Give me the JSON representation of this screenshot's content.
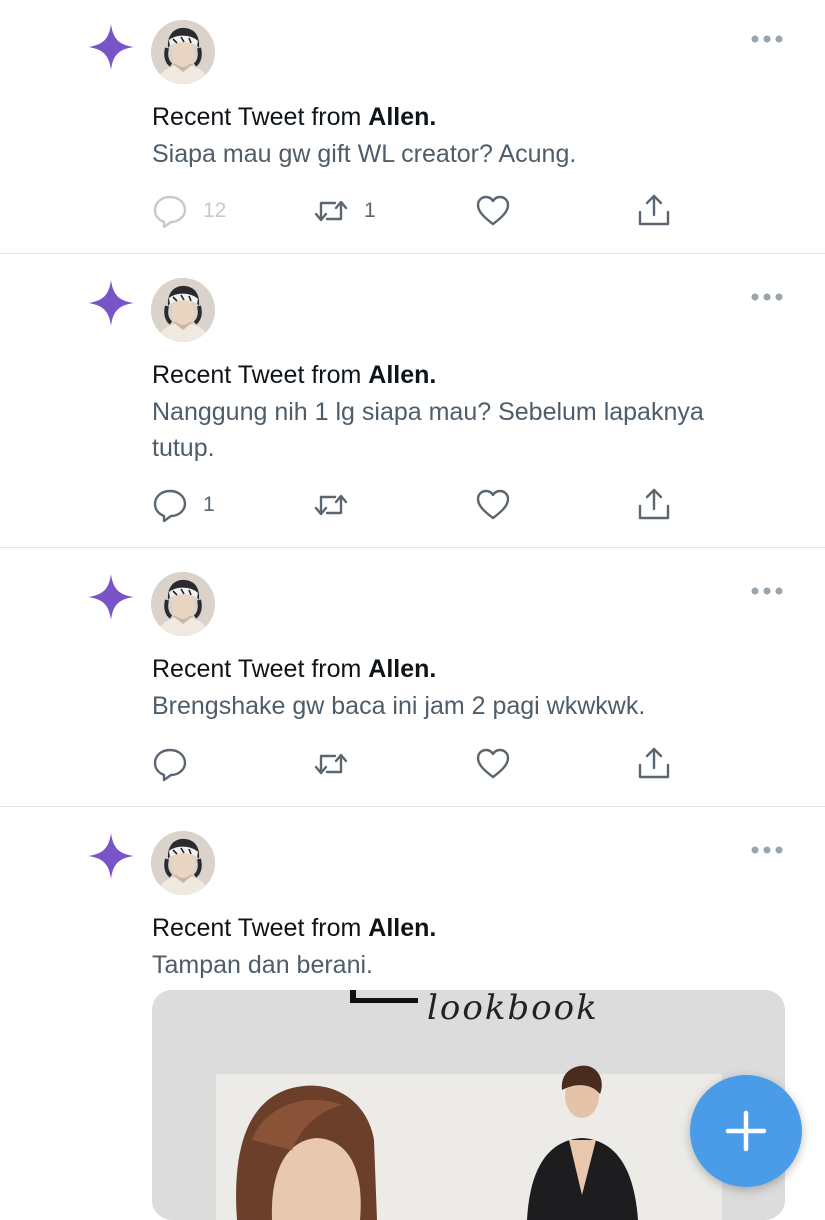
{
  "colors": {
    "accent": "#7a53c8",
    "fab": "#4a9ce8",
    "icon_gray": "#5b6670",
    "text_secondary": "#4f5d6a"
  },
  "tweets": [
    {
      "title_prefix": "Recent Tweet from ",
      "author": "Allen.",
      "text": "Siapa mau gw gift WL creator? Acung.",
      "reply_count": "12",
      "retweet_count": "1",
      "like_count": ""
    },
    {
      "title_prefix": "Recent Tweet from ",
      "author": "Allen.",
      "text": "Nanggung nih 1 lg siapa mau? Sebelum lapaknya tutup.",
      "reply_count": "1",
      "retweet_count": "",
      "like_count": ""
    },
    {
      "title_prefix": "Recent Tweet from ",
      "author": "Allen.",
      "text": "Brengshake gw baca ini jam 2 pagi wkwkwk.",
      "reply_count": "",
      "retweet_count": "",
      "like_count": ""
    },
    {
      "title_prefix": "Recent Tweet from ",
      "author": "Allen.",
      "text": "Tampan dan berani.",
      "media_caption": "lookbook"
    }
  ],
  "icons": {
    "sparkle": "sparkle-icon",
    "more": "more-options-icon",
    "reply": "reply-icon",
    "retweet": "retweet-icon",
    "like": "heart-icon",
    "share": "share-icon",
    "compose": "plus-icon"
  }
}
